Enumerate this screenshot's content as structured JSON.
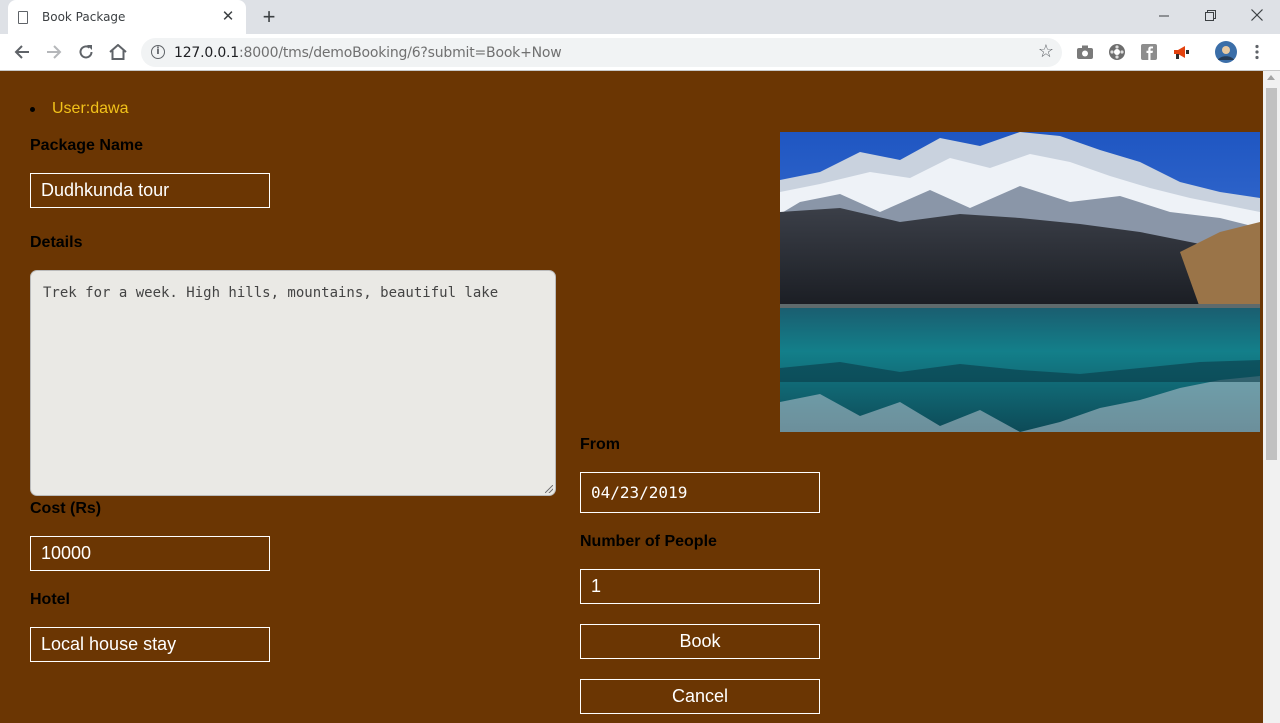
{
  "browser": {
    "tab_title": "Book Package",
    "tab_close": "✕",
    "new_tab": "+",
    "url_host": "127.0.0.1",
    "url_rest": ":8000/tms/demoBooking/6?submit=Book+Now"
  },
  "user": {
    "label": "User:dawa"
  },
  "form": {
    "package_name_label": "Package Name",
    "package_name_value": "Dudhkunda tour",
    "details_label": "Details",
    "details_value": "Trek for a week. High hills, mountains, beautiful lake",
    "cost_label": "Cost (Rs)",
    "cost_value": "10000",
    "hotel_label": "Hotel",
    "hotel_value": "Local house stay",
    "from_label": "From",
    "from_value": "04/23/2019",
    "people_label": "Number of People",
    "people_value": "1",
    "book_label": "Book",
    "cancel_label": "Cancel"
  },
  "colors": {
    "page_bg": "#6b3603",
    "user_text": "#f2c21a",
    "field_border": "#ffffff"
  },
  "icons": [
    "document-icon",
    "back-icon",
    "forward-icon",
    "reload-icon",
    "home-icon",
    "info-icon",
    "star-icon",
    "camera-icon",
    "film-icon",
    "facebook-icon",
    "megaphone-icon",
    "avatar-icon",
    "menu-dots-icon"
  ]
}
